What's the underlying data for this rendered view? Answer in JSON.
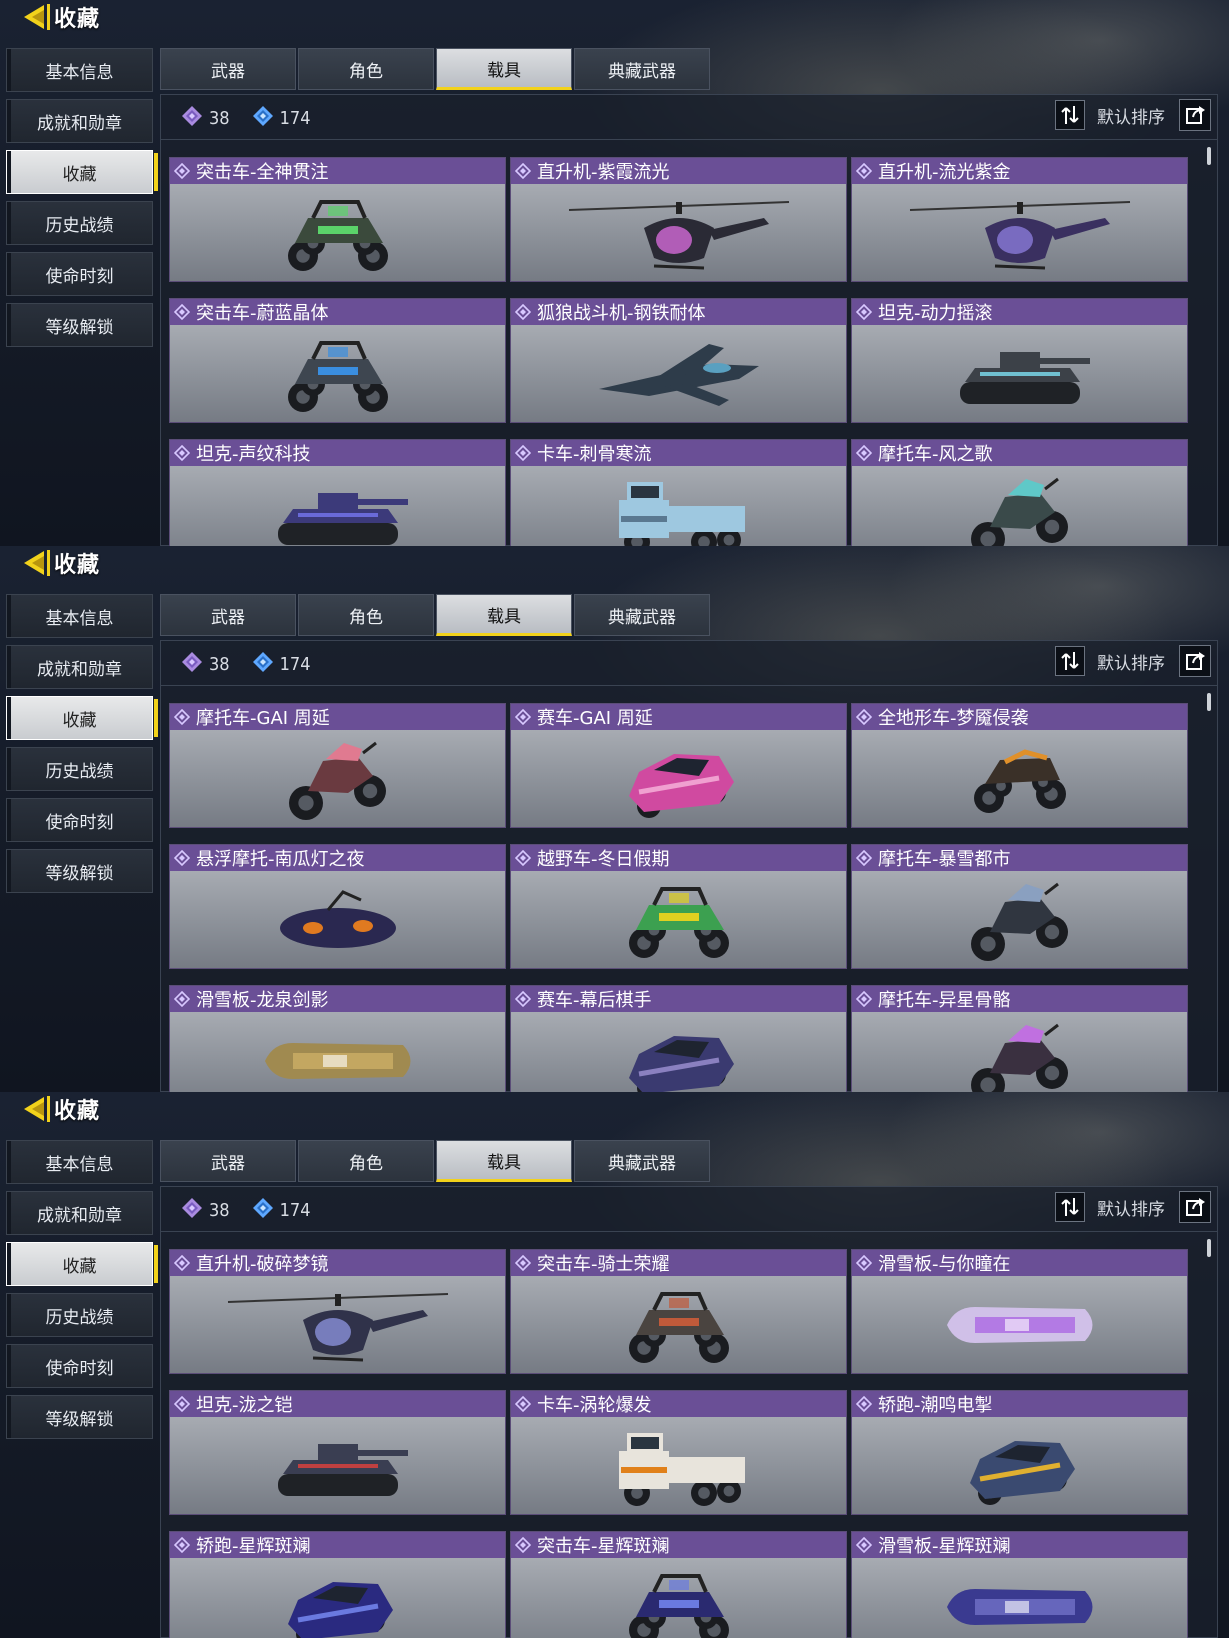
{
  "page": {
    "title": "收藏"
  },
  "sidebar": {
    "items": [
      {
        "label": "基本信息",
        "active": false
      },
      {
        "label": "成就和勋章",
        "active": false
      },
      {
        "label": "收藏",
        "active": true
      },
      {
        "label": "历史战绩",
        "active": false
      },
      {
        "label": "使命时刻",
        "active": false
      },
      {
        "label": "等级解锁",
        "active": false
      }
    ]
  },
  "tabs": [
    {
      "label": "武器",
      "active": false
    },
    {
      "label": "角色",
      "active": false
    },
    {
      "label": "载具",
      "active": true
    },
    {
      "label": "典藏武器",
      "active": false
    }
  ],
  "stats": {
    "purple_count": "38",
    "blue_count": "174"
  },
  "sort": {
    "label": "默认排序"
  },
  "colors": {
    "accent_yellow": "#f2d21b",
    "card_header_purple": "#6a4f96",
    "diamond_purple": "#a98be0",
    "diamond_blue": "#5fa8ff"
  },
  "panels": [
    {
      "cards": [
        {
          "name": "突击车-全神贯注",
          "kind": "buggy",
          "color": "#3b4a3c",
          "accent": "#5bd36a"
        },
        {
          "name": "直升机-紫霞流光",
          "kind": "heli",
          "color": "#2a2a35",
          "accent": "#d36ad8"
        },
        {
          "name": "直升机-流光紫金",
          "kind": "heli",
          "color": "#3a3060",
          "accent": "#8a7ad8"
        },
        {
          "name": "突击车-蔚蓝晶体",
          "kind": "buggy",
          "color": "#3e4650",
          "accent": "#3a8ee0"
        },
        {
          "name": "狐狼战斗机-钢铁耐体",
          "kind": "jet",
          "color": "#2e3c4a",
          "accent": "#5aa0c0"
        },
        {
          "name": "坦克-动力摇滚",
          "kind": "tank",
          "color": "#3c4148",
          "accent": "#70c0d0"
        },
        {
          "name": "坦克-声纹科技",
          "kind": "tank",
          "color": "#3c3a7a",
          "accent": "#6a6ad8"
        },
        {
          "name": "卡车-刺骨寒流",
          "kind": "truck",
          "color": "#9ec8e0",
          "accent": "#5a7890"
        },
        {
          "name": "摩托车-风之歌",
          "kind": "moto",
          "color": "#3a4a4a",
          "accent": "#5fc8c8"
        }
      ]
    },
    {
      "cards": [
        {
          "name": "摩托车-GAI 周延",
          "kind": "moto",
          "color": "#6a3a40",
          "accent": "#e07a90"
        },
        {
          "name": "赛车-GAI 周延",
          "kind": "car",
          "color": "#d04aa0",
          "accent": "#f0a0d0"
        },
        {
          "name": "全地形车-梦魇侵袭",
          "kind": "atv",
          "color": "#3a3028",
          "accent": "#e0902a"
        },
        {
          "name": "悬浮摩托-南瓜灯之夜",
          "kind": "hover",
          "color": "#2a2850",
          "accent": "#e07a20"
        },
        {
          "name": "越野车-冬日假期",
          "kind": "buggy",
          "color": "#3ca050",
          "accent": "#e0d020"
        },
        {
          "name": "摩托车-暴雪都市",
          "kind": "moto",
          "color": "#303640",
          "accent": "#8aa0c0"
        },
        {
          "name": "滑雪板-龙泉剑影",
          "kind": "board",
          "color": "#a08a50",
          "accent": "#e0c070"
        },
        {
          "name": "赛车-幕后棋手",
          "kind": "car",
          "color": "#3a3a70",
          "accent": "#8a80c0"
        },
        {
          "name": "摩托车-异星骨骼",
          "kind": "moto",
          "color": "#3a3040",
          "accent": "#c070e0"
        }
      ]
    },
    {
      "cards": [
        {
          "name": "直升机-破碎梦镜",
          "kind": "heli",
          "color": "#30324a",
          "accent": "#8a90d8"
        },
        {
          "name": "突击车-骑士荣耀",
          "kind": "buggy",
          "color": "#4a4440",
          "accent": "#c05a3a"
        },
        {
          "name": "滑雪板-与你瞳在",
          "kind": "board",
          "color": "#d0c0e8",
          "accent": "#9a40e0"
        },
        {
          "name": "坦克-泷之铠",
          "kind": "tank",
          "color": "#3a3e52",
          "accent": "#c04040"
        },
        {
          "name": "卡车-涡轮爆发",
          "kind": "truck",
          "color": "#e8e4dc",
          "accent": "#e0801a"
        },
        {
          "name": "轿跑-潮鸣电掣",
          "kind": "car",
          "color": "#3a4a70",
          "accent": "#e0b030"
        },
        {
          "name": "轿跑-星辉斑斓",
          "kind": "car",
          "color": "#2a2a80",
          "accent": "#6a7ae0"
        },
        {
          "name": "突击车-星辉斑斓",
          "kind": "buggy",
          "color": "#2a2a70",
          "accent": "#6a7ae0"
        },
        {
          "name": "滑雪板-星辉斑斓",
          "kind": "board",
          "color": "#3a3a90",
          "accent": "#8a8ae0"
        }
      ]
    }
  ]
}
